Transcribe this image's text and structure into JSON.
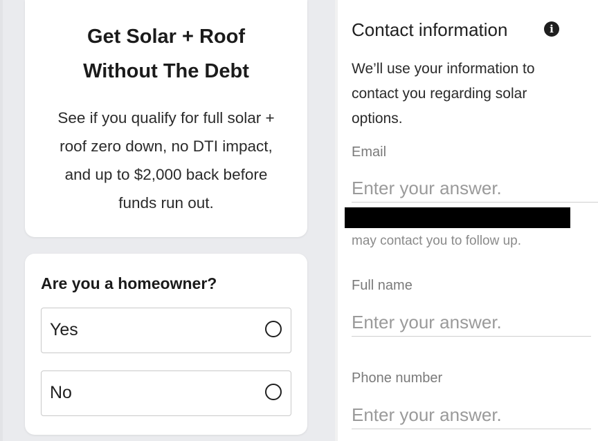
{
  "hero": {
    "title_line1": "Get Solar + Roof",
    "title_line2": "Without The Debt",
    "desc_line1": "See if you qualify for full solar +",
    "desc_line2": "roof zero down, no DTI impact,",
    "desc_line3": "and up to $2,000 back before",
    "desc_line4": "funds run out."
  },
  "question": {
    "label": "Are you a homeowner?",
    "options": [
      {
        "label": "Yes",
        "selected": false
      },
      {
        "label": "No",
        "selected": false
      }
    ]
  },
  "contact": {
    "heading": "Contact information",
    "info_icon": "info-icon",
    "desc_line1": "We’ll use your information to",
    "desc_line2": "contact you regarding solar",
    "desc_line3": "options.",
    "followup_text": "may contact you to follow up.",
    "fields": {
      "email": {
        "label": "Email",
        "placeholder": "Enter your answer.",
        "value": ""
      },
      "full_name": {
        "label": "Full name",
        "placeholder": "Enter your answer.",
        "value": ""
      },
      "phone": {
        "label": "Phone number",
        "placeholder": "Enter your answer.",
        "value": ""
      }
    }
  },
  "colors": {
    "left_background": "#eaebee",
    "card_background": "#ffffff",
    "redaction": "#000000"
  }
}
